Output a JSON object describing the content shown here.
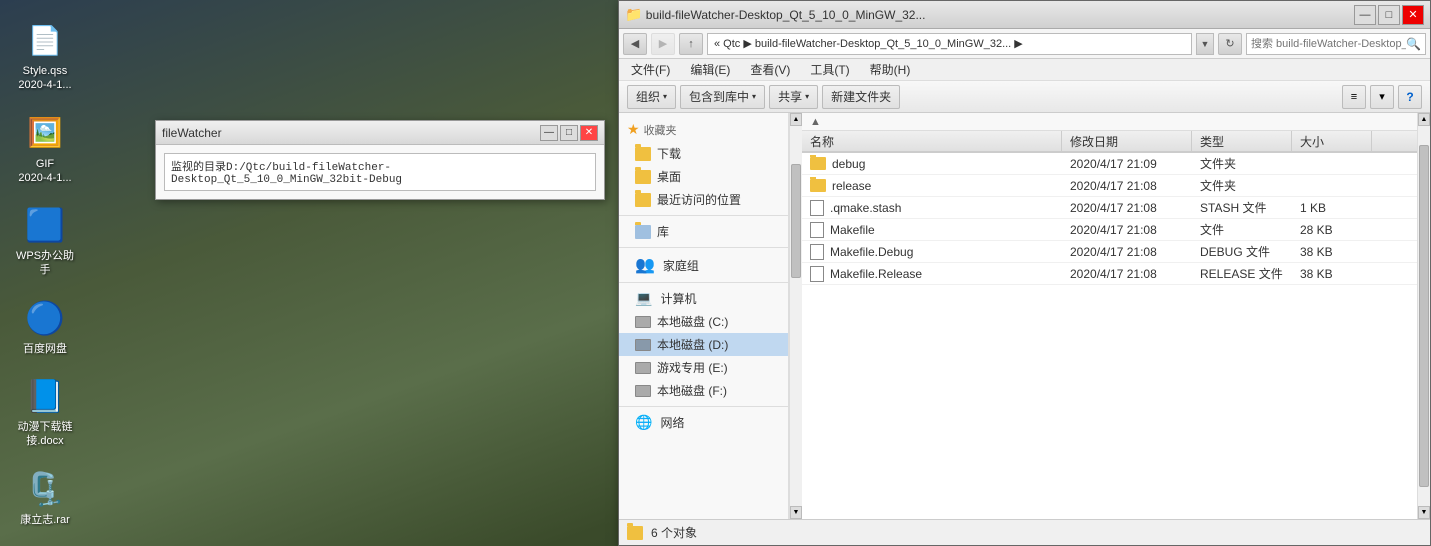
{
  "desktop": {
    "icons": [
      {
        "id": "style-qss",
        "label": "Style.qss\n2020-4-1...",
        "emoji": "📄"
      },
      {
        "id": "gif",
        "label": "GIF\n2020-4-1...",
        "emoji": "🖼️"
      },
      {
        "id": "wps",
        "label": "WPS办公助手",
        "emoji": "🟦"
      },
      {
        "id": "baidu",
        "label": "百度网盘",
        "emoji": "🔵"
      },
      {
        "id": "docx",
        "label": "动漫下载链接.docx",
        "emoji": "📘"
      },
      {
        "id": "rar",
        "label": "康立志.rar",
        "emoji": "🗜️"
      }
    ]
  },
  "filewatcher": {
    "title": "fileWatcher",
    "path": "监视的目录D:/Qtc/build-fileWatcher-Desktop_Qt_5_10_0_MinGW_32bit-Debug",
    "btn_minimize": "—",
    "btn_maximize": "□",
    "btn_close": "✕"
  },
  "explorer": {
    "title": "build-fileWatcher-Desktop_Qt_5_10_0_MinGW_32...",
    "win_controls": [
      "—",
      "□",
      "✕"
    ],
    "address": "« Qtc ▶ build-fileWatcher-Desktop_Qt_5_10_0_MinGW_32... ▶",
    "search_placeholder": "搜索 build-fileWatcher-Desktop_Q...",
    "nav_back": "◀",
    "nav_forward": "▶",
    "nav_up": "▲",
    "nav_refresh": "↻",
    "menu": [
      "文件(F)",
      "编辑(E)",
      "查看(V)",
      "工具(T)",
      "帮助(H)"
    ],
    "toolbar": [
      "组织 ▾",
      "包含到库中 ▾",
      "共享 ▾",
      "新建文件夹"
    ],
    "columns": [
      "名称",
      "修改日期",
      "类型",
      "大小"
    ],
    "files": [
      {
        "name": "debug",
        "date": "2020/4/17 21:09",
        "type": "文件夹",
        "size": "",
        "isFolder": true
      },
      {
        "name": "release",
        "date": "2020/4/17 21:08",
        "type": "文件夹",
        "size": "",
        "isFolder": true
      },
      {
        "name": ".qmake.stash",
        "date": "2020/4/17 21:08",
        "type": "STASH 文件",
        "size": "1 KB",
        "isFolder": false
      },
      {
        "name": "Makefile",
        "date": "2020/4/17 21:08",
        "type": "文件",
        "size": "28 KB",
        "isFolder": false
      },
      {
        "name": "Makefile.Debug",
        "date": "2020/4/17 21:08",
        "type": "DEBUG 文件",
        "size": "38 KB",
        "isFolder": false
      },
      {
        "name": "Makefile.Release",
        "date": "2020/4/17 21:08",
        "type": "RELEASE 文件",
        "size": "38 KB",
        "isFolder": false
      }
    ],
    "sidebar": {
      "favorites_label": "收藏夹",
      "download_label": "下载",
      "desktop_label": "桌面",
      "recent_label": "最近访问的位置",
      "library_label": "库",
      "homegroup_label": "家庭组",
      "computer_label": "计算机",
      "drives": [
        {
          "label": "本地磁盘 (C:)"
        },
        {
          "label": "本地磁盘 (D:)",
          "active": true
        },
        {
          "label": "游戏专用 (E:)"
        },
        {
          "label": "本地磁盘 (F:)"
        }
      ],
      "network_label": "网络"
    },
    "statusbar": {
      "count": "6 个对象"
    }
  }
}
